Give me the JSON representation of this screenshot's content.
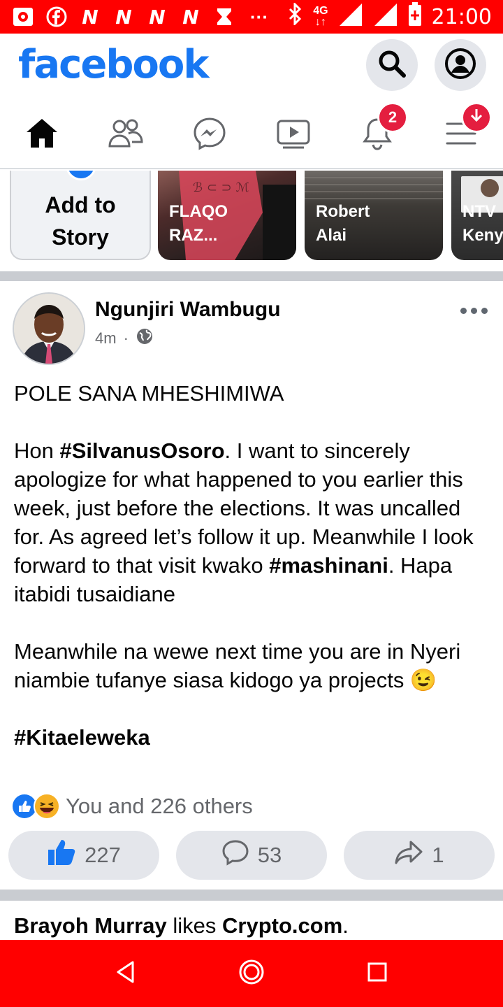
{
  "status_bar": {
    "left_icons": [
      "notification-icon",
      "facebook-icon",
      "N",
      "N",
      "N",
      "N",
      "hourglass-icon"
    ],
    "more": "···",
    "network": "4G",
    "time": "21:00"
  },
  "header": {
    "logo": "facebook",
    "search_icon": "search-icon",
    "profile_icon": "profile-icon"
  },
  "tabs": {
    "items": [
      "home-icon",
      "friends-icon",
      "messenger-icon",
      "watch-icon",
      "notifications-icon",
      "menu-icon"
    ],
    "notifications_badge": "2",
    "active": "home",
    "accent": "#1877f2"
  },
  "stories": {
    "add_label": "Add to\nStory",
    "items": [
      {
        "name": "FLAQO\nRAZ..."
      },
      {
        "name": "Robert\nAlai"
      },
      {
        "name": "NTV\nKeny"
      }
    ]
  },
  "post": {
    "author": "Ngunjiri Wambugu",
    "time": "4m",
    "dot": "·",
    "audience_icon": "globe-icon",
    "paragraphs": [
      [
        {
          "t": "POLE SANA MHESHIMIWA"
        }
      ],
      [],
      [
        {
          "t": "Hon "
        },
        {
          "t": "#SilvanusOsoro",
          "b": true
        },
        {
          "t": ". I want to sincerely apologize for what happened to you earlier this week, just before the elections. It was uncalled for. As agreed let’s follow it up. Meanwhile I look forward to that visit kwako "
        },
        {
          "t": "#mashinani",
          "b": true
        },
        {
          "t": ". Hapa itabidi tusaidiane"
        }
      ],
      [],
      [
        {
          "t": "Meanwhile na wewe next time you are in Nyeri niambie tufanye siasa kidogo ya projects 😉"
        }
      ],
      [],
      [
        {
          "t": "#Kitaeleweka",
          "b": true
        }
      ]
    ],
    "reactions_text": "You and 226 others",
    "like_count": "227",
    "comment_count": "53",
    "share_count": "1",
    "like_color": "#1877f2"
  },
  "next_post": {
    "actor": "Brayoh Murray",
    "verb": " likes ",
    "page": "Crypto.com",
    "end": "."
  },
  "nav": {
    "back": "back-icon",
    "home": "home-nav-icon",
    "recents": "recents-icon"
  },
  "colors": {
    "system_bars": "#ff0000",
    "brand": "#1877f2",
    "badge": "#e41e3f"
  }
}
